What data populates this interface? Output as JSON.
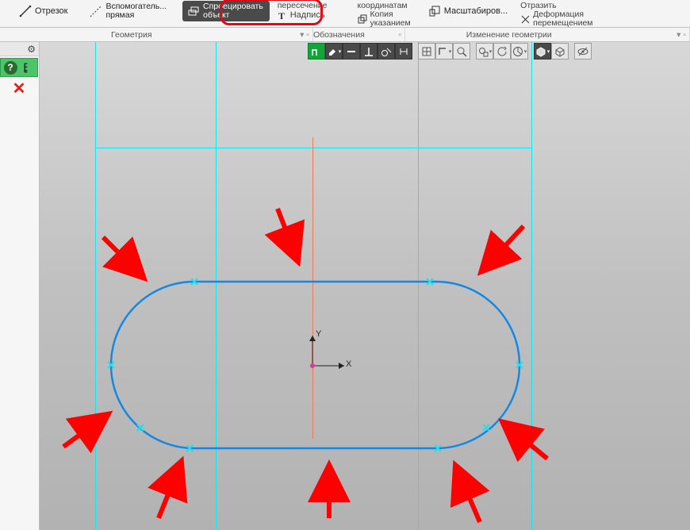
{
  "ribbon": {
    "segment_btn": "Отрезок",
    "aux_btn_line1": "Вспомогатель...",
    "aux_btn_line2": "прямая",
    "project_line1": "Спроецировать",
    "project_line2": "объект",
    "intersect_partial": "пересечение",
    "text_btn": "Надпись",
    "coords_partial": "координатам",
    "copy_line1": "Копия",
    "copy_line2": "указанием",
    "scale_btn": "Масштабиров...",
    "mirror_partial": "Отразить",
    "deform_line1": "Деформация",
    "deform_line2": "перемещением"
  },
  "groups": {
    "geometry": "Геометрия",
    "annotations": "Обозначения",
    "edit_geom": "Изменение геометрии"
  },
  "axes": {
    "x": "X",
    "y": "Y"
  }
}
